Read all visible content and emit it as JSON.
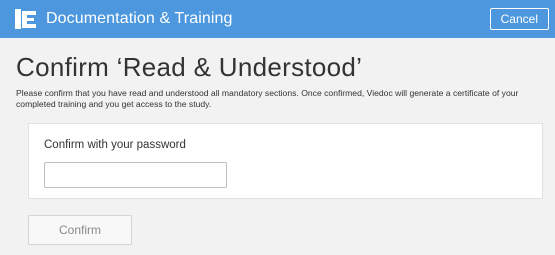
{
  "header": {
    "title": "Documentation & Training",
    "logo_icon": "viedoc-logo-icon",
    "cancel_label": "Cancel",
    "background_color": "#4c97dd"
  },
  "main": {
    "heading": "Confirm ‘Read & Understood’",
    "intro": "Please confirm that you have read and understood all mandatory sections. Once confirmed, Viedoc will generate a certificate of your completed training and you get access to the study.",
    "password_panel": {
      "label": "Confirm with your password",
      "password_value": "",
      "password_placeholder": ""
    },
    "confirm_label": "Confirm"
  }
}
